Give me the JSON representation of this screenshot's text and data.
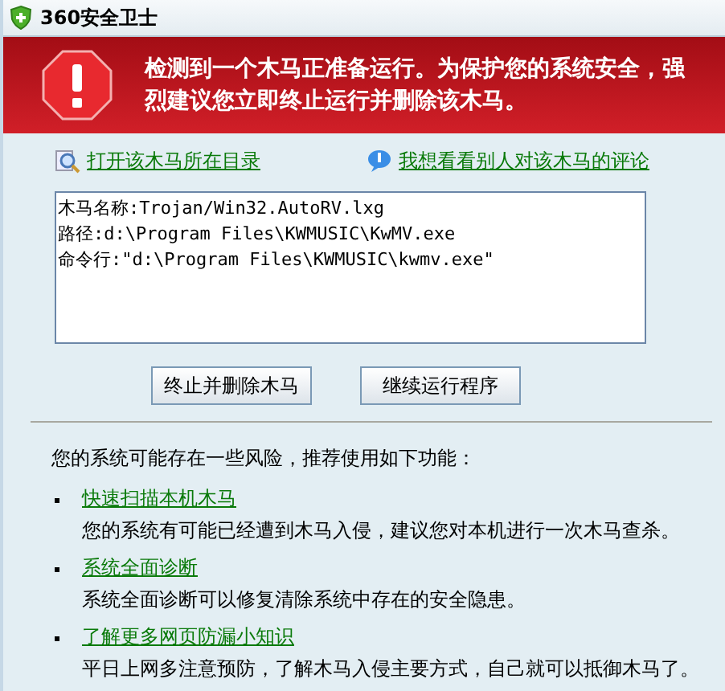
{
  "window": {
    "title": "360安全卫士"
  },
  "alert": {
    "message": "检测到一个木马正准备运行。为保护您的系统安全，强烈建议您立即终止运行并删除该木马。"
  },
  "links": [
    {
      "kind": "folder",
      "label": "打开该木马所在目录"
    },
    {
      "kind": "comment",
      "label": "我想看看别人对该木马的评论"
    }
  ],
  "details": [
    "木马名称:Trojan/Win32.AutoRV.lxg",
    "路径:d:\\Program Files\\KWMUSIC\\KwMV.exe",
    "命令行:\"d:\\Program Files\\KWMUSIC\\kwmv.exe\""
  ],
  "buttons": [
    "终止并删除木马",
    "继续运行程序"
  ],
  "recommend": {
    "intro": "您的系统可能存在一些风险，推荐使用如下功能：",
    "items": [
      {
        "link": "快速扫描本机木马",
        "description": "您的系统有可能已经遭到木马入侵，建议您对本机进行一次木马查杀。"
      },
      {
        "link": "系统全面诊断",
        "description": "系统全面诊断可以修复清除系统中存在的安全隐患。"
      },
      {
        "link": "了解更多网页防漏小知识",
        "description": "平日上网多注意预防，了解木马入侵主要方式，自己就可以抵御木马了。"
      }
    ]
  }
}
